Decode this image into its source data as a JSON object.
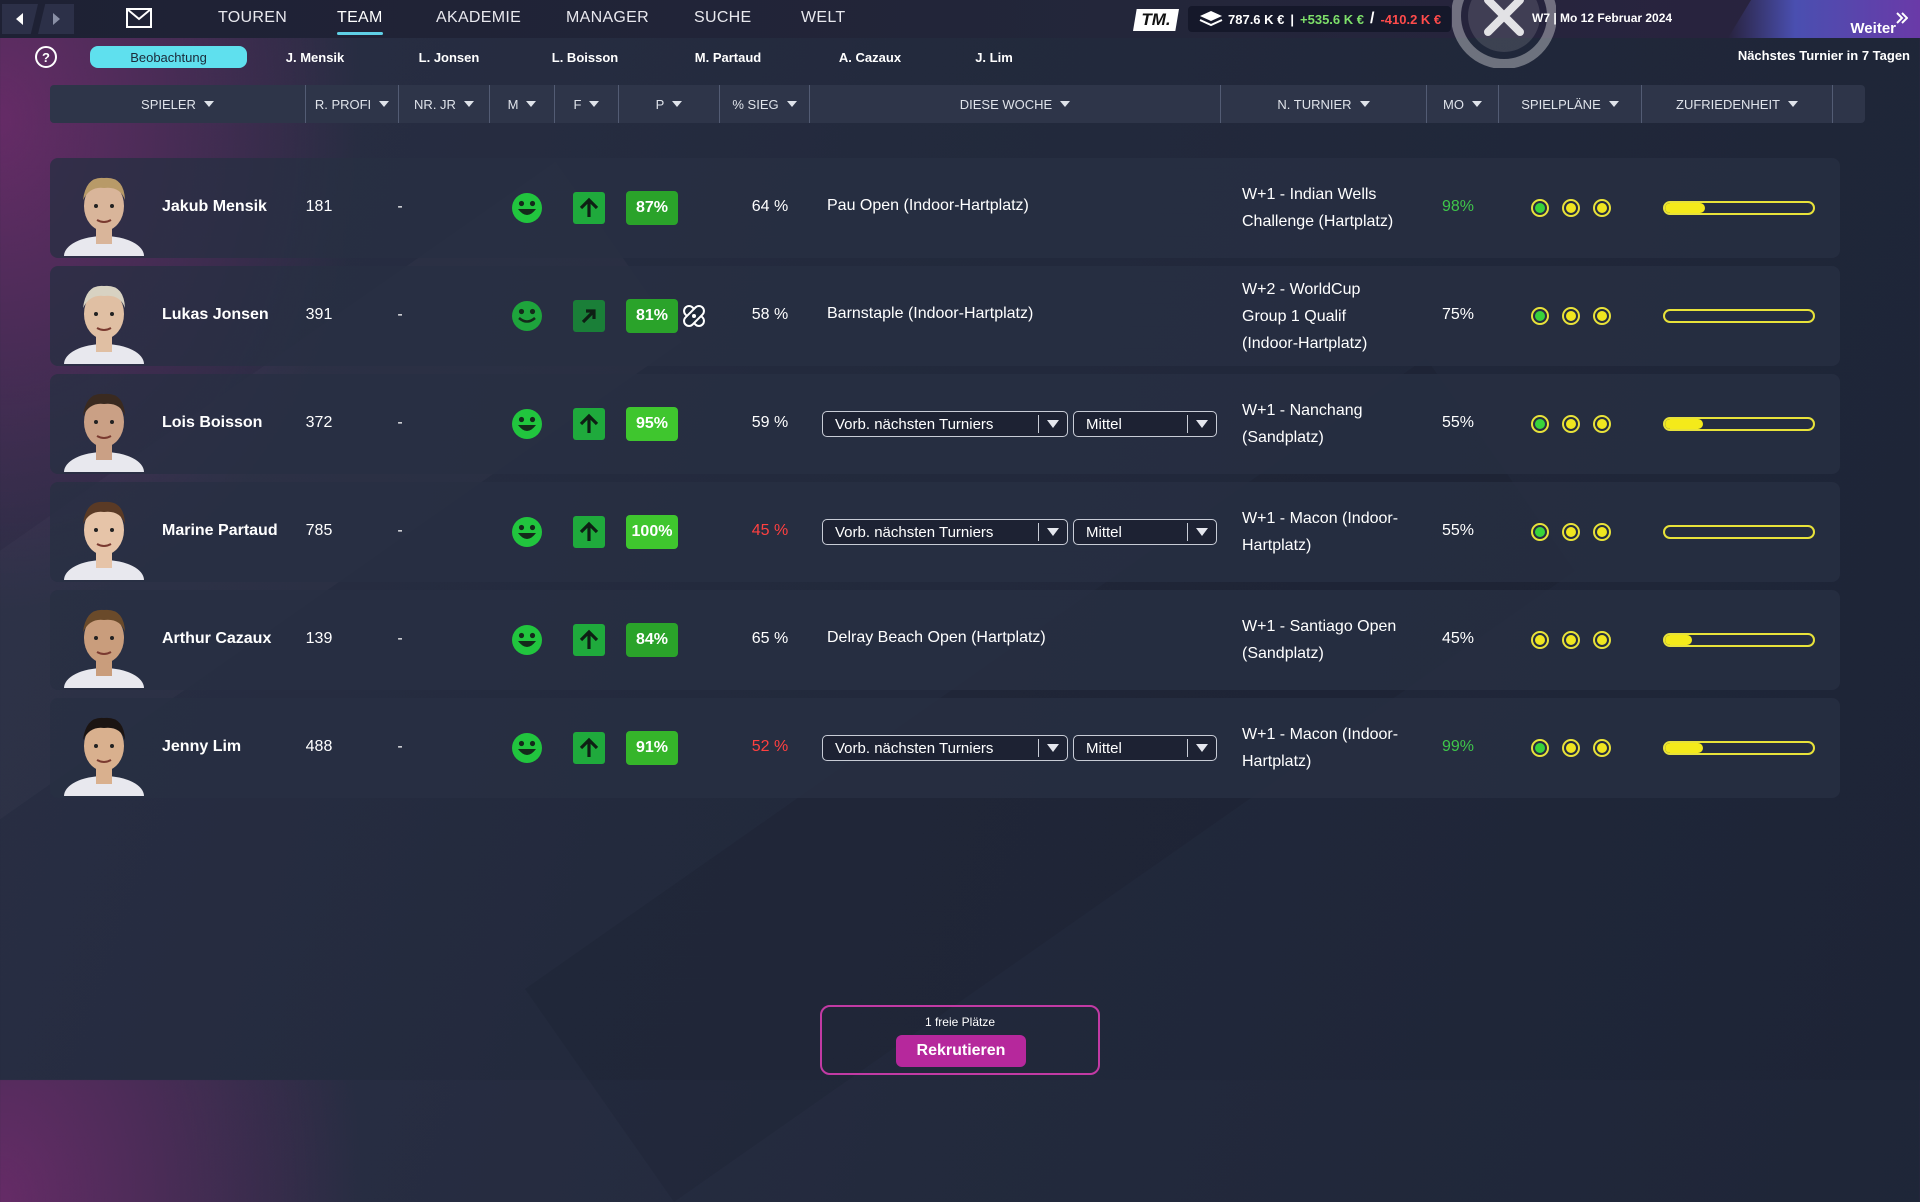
{
  "nav": {
    "back_icon": "chevron-left-icon",
    "forward_icon": "chevron-right-icon",
    "mail_icon": "mail-icon",
    "tabs": [
      "TOUREN",
      "TEAM",
      "AKADEMIE",
      "MANAGER",
      "SUCHE",
      "WELT"
    ],
    "active_tab": "TEAM"
  },
  "header": {
    "logo": "TM.",
    "balance": "787.6 K €",
    "sep1": "|",
    "income": "+535.6 K €",
    "sep2": "/",
    "expense": "-410.2 K €",
    "date": "W7 | Mo 12 Februar 2024",
    "continue": "Weiter",
    "continue_icon": "double-chevron-right-icon"
  },
  "subtabs": {
    "help": "?",
    "items": [
      "Beobachtung",
      "J. Mensik",
      "L. Jonsen",
      "L. Boisson",
      "M. Partaud",
      "A. Cazaux",
      "J. Lim"
    ],
    "active": "Beobachtung",
    "next_tournament": "Nächstes Turnier in 7 Tagen"
  },
  "columns": [
    "SPIELER",
    "R. PROFI",
    "NR. JR",
    "M",
    "F",
    "P",
    "% SIEG",
    "DIESE WOCHE",
    "N. TURNIER",
    "MO",
    "SPIELPLÄNE",
    "ZUFRIEDENHEIT"
  ],
  "players": [
    {
      "name": "Jakub Mensik",
      "rank": "181",
      "jr": "-",
      "p": "87%",
      "win": "64 %",
      "win_color": "#ffffff",
      "week": "Pau Open (Indoor-Hartplatz)",
      "week_dd": false,
      "next": [
        "W+1 - Indian Wells",
        "Challenge (Hartplatz)"
      ],
      "mo": "98%",
      "mo_color": "#3fc64a",
      "dots": [
        "green",
        "yellow",
        "yellow"
      ],
      "satisfaction": 0.27,
      "injury": false,
      "arrow": "up"
    },
    {
      "name": "Lukas Jonsen",
      "rank": "391",
      "jr": "-",
      "p": "81%",
      "win": "58 %",
      "win_color": "#ffffff",
      "week": "Barnstaple (Indoor-Hartplatz)",
      "week_dd": false,
      "next": [
        "W+2 - WorldCup",
        "Group 1 Qualif",
        "(Indoor-Hartplatz)"
      ],
      "mo": "75%",
      "mo_color": "#ffffff",
      "dots": [
        "green",
        "yellow",
        "yellow"
      ],
      "satisfaction": 0.0,
      "injury": true,
      "arrow": "diag"
    },
    {
      "name": "Lois Boisson",
      "rank": "372",
      "jr": "-",
      "p": "95%",
      "win": "59 %",
      "win_color": "#ffffff",
      "week_dd": true,
      "dd1": "Vorb. nächsten Turniers",
      "dd2": "Mittel",
      "next": [
        "W+1 - Nanchang",
        "(Sandplatz)"
      ],
      "mo": "55%",
      "mo_color": "#ffffff",
      "dots": [
        "green",
        "yellow",
        "yellow"
      ],
      "satisfaction": 0.26,
      "injury": false,
      "arrow": "up"
    },
    {
      "name": "Marine Partaud",
      "rank": "785",
      "jr": "-",
      "p": "100%",
      "win": "45 %",
      "win_color": "#ff4040",
      "week_dd": true,
      "dd1": "Vorb. nächsten Turniers",
      "dd2": "Mittel",
      "next": [
        "W+1 - Macon (Indoor-",
        "Hartplatz)"
      ],
      "mo": "55%",
      "mo_color": "#ffffff",
      "dots": [
        "green",
        "yellow",
        "yellow"
      ],
      "satisfaction": 0.0,
      "injury": false,
      "arrow": "up"
    },
    {
      "name": "Arthur Cazaux",
      "rank": "139",
      "jr": "-",
      "p": "84%",
      "win": "65 %",
      "win_color": "#ffffff",
      "week": "Delray Beach Open (Hartplatz)",
      "week_dd": false,
      "next": [
        "W+1 - Santiago Open",
        "(Sandplatz)"
      ],
      "mo": "45%",
      "mo_color": "#ffffff",
      "dots": [
        "yellow",
        "yellow",
        "yellow"
      ],
      "satisfaction": 0.18,
      "injury": false,
      "arrow": "up"
    },
    {
      "name": "Jenny Lim",
      "rank": "488",
      "jr": "-",
      "p": "91%",
      "win": "52 %",
      "win_color": "#ff4040",
      "week_dd": true,
      "dd1": "Vorb. nächsten Turniers",
      "dd2": "Mittel",
      "next": [
        "W+1 - Macon (Indoor-",
        "Hartplatz)"
      ],
      "mo": "99%",
      "mo_color": "#3fc64a",
      "dots": [
        "green",
        "yellow",
        "yellow"
      ],
      "satisfaction": 0.26,
      "injury": false,
      "arrow": "up"
    }
  ],
  "recruit": {
    "free": "1 freie Plätze",
    "button": "Rekrutieren"
  },
  "colors": {
    "accent": "#5fe0ee",
    "brand": "#b6289c",
    "badge_green": "#3fb82e",
    "positive": "#7ee06a",
    "negative": "#ff4b4b",
    "bar_yellow": "#f4ea1a"
  }
}
